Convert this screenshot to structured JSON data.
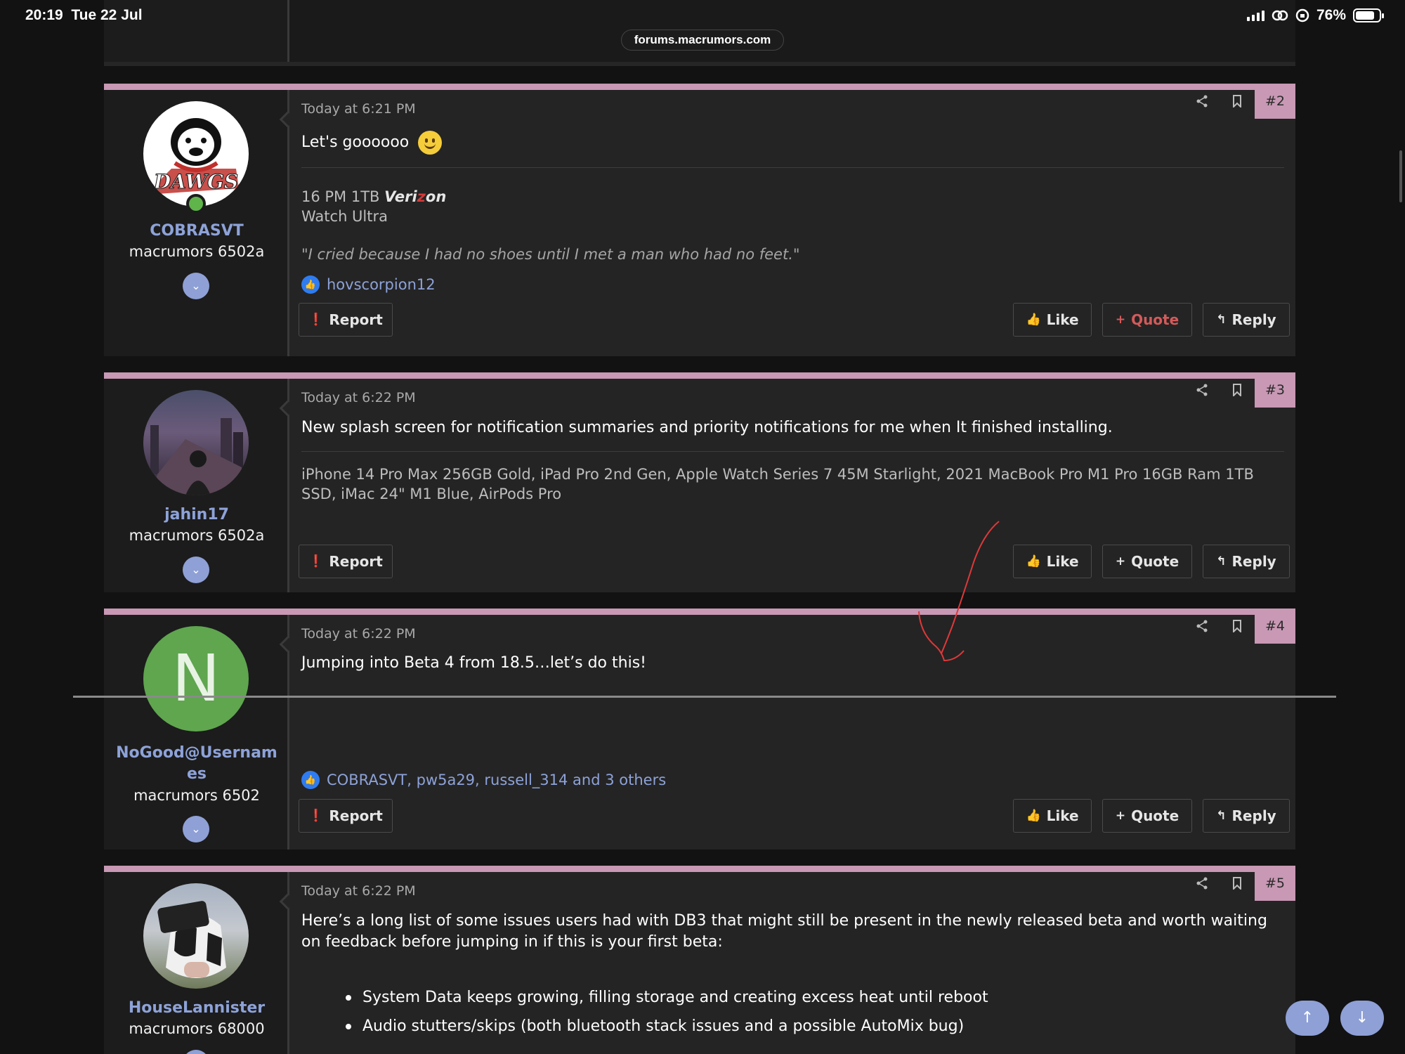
{
  "status_bar": {
    "time": "20:19",
    "date": "Tue 22 Jul",
    "battery": "76%",
    "url": "forums.macrumors.com"
  },
  "colors": {
    "accent_pink": "#c898b4",
    "username_blue": "#8da2d8",
    "quote_red": "#d45a5a",
    "reaction_blue": "#2f7cf0"
  },
  "buttons": {
    "report": "Report",
    "like": "Like",
    "quote": "Quote",
    "reply": "Reply"
  },
  "posts": [
    {
      "number": "#2",
      "username": "COBRASVT",
      "user_title": "macrumors 6502a",
      "avatar_text": "DAWGS",
      "date": "Today at 6:21 PM",
      "body": "Let's goooooo",
      "signature_line1": "16 PM 1TB",
      "signature_carrier_a": "Veri",
      "signature_carrier_b": "z",
      "signature_carrier_c": "on",
      "signature_line2": "Watch Ultra",
      "signature_quote": "\"I cried because I had no shoes until I met a man who had no feet.\"",
      "reactions": "hovscorpion12"
    },
    {
      "number": "#3",
      "username": "jahin17",
      "user_title": "macrumors 6502a",
      "date": "Today at 6:22 PM",
      "body": "New splash screen for notification summaries and priority notifications for me when It finished installing.",
      "signature": "iPhone 14 Pro Max 256GB Gold, iPad Pro 2nd Gen, Apple Watch Series 7 45M Starlight, 2021 MacBook Pro M1 Pro 16GB Ram 1TB SSD, iMac 24\" M1 Blue, AirPods Pro"
    },
    {
      "number": "#4",
      "username_line1": "NoGood@Usernam",
      "username_line2": "es",
      "user_title": "macrumors 6502",
      "avatar_letter": "N",
      "date": "Today at 6:22 PM",
      "body": "Jumping into Beta 4 from 18.5…let’s do this!",
      "reactions": "COBRASVT, pw5a29, russell_314 and 3 others"
    },
    {
      "number": "#5",
      "username": "HouseLannister",
      "user_title": "macrumors 68000",
      "date": "Today at 6:22 PM",
      "body": "Here’s a long list of some issues users had with DB3 that might still be present in the newly released beta and worth waiting on feedback before jumping in if this is your first beta:",
      "bullets": [
        "System Data keeps growing, filling storage and creating excess heat until reboot",
        "Audio stutters/skips (both bluetooth stack issues and a possible AutoMix bug)"
      ]
    }
  ]
}
